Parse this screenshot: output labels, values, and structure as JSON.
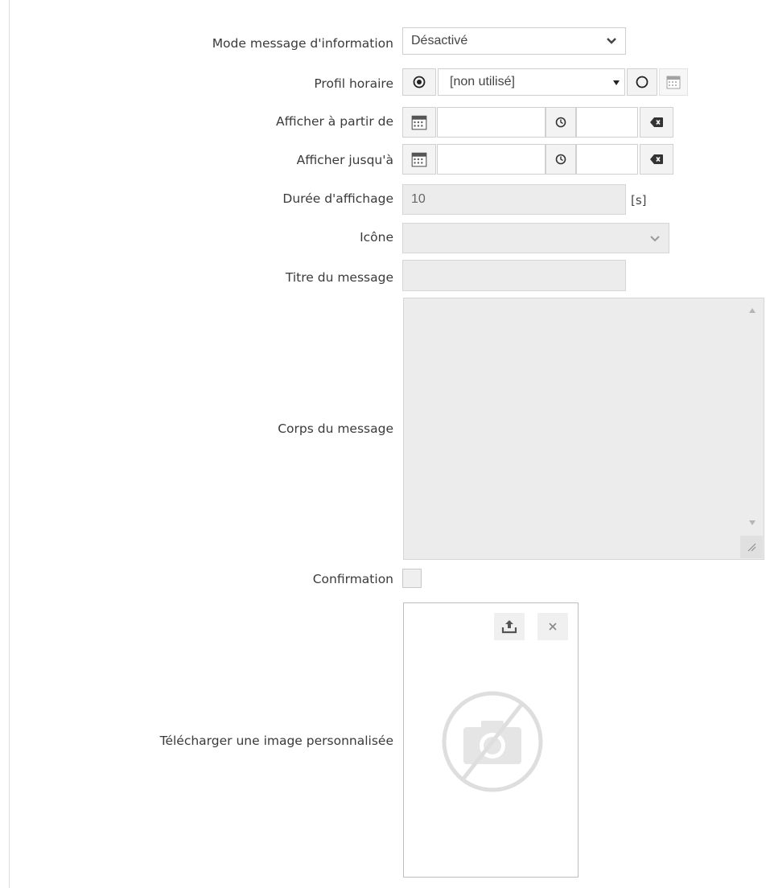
{
  "form": {
    "mode": {
      "label": "Mode message d'information",
      "value": "Désactivé"
    },
    "profile": {
      "label": "Profil horaire",
      "value": "[non utilisé]"
    },
    "from": {
      "label": "Afficher à partir de"
    },
    "until": {
      "label": "Afficher jusqu'à"
    },
    "duration": {
      "label": "Durée d'affichage",
      "value": "10",
      "unit": "[s]"
    },
    "icon": {
      "label": "Icône",
      "value": ""
    },
    "title": {
      "label": "Titre du message",
      "value": ""
    },
    "body": {
      "label": "Corps du message",
      "value": ""
    },
    "confirmation": {
      "label": "Confirmation",
      "checked": false
    },
    "image": {
      "label": "Télécharger une image personnalisée"
    }
  },
  "icons": {
    "mode_select": "chevron-down-icon",
    "profile_radio_on": "radio-selected-icon",
    "profile_select": "caret-down-icon",
    "profile_radio_off": "radio-empty-icon",
    "calendar": "calendar-icon",
    "clock": "clock-icon",
    "clear": "backspace-clear-icon",
    "icon_select": "chevron-down-icon",
    "upload": "upload-icon",
    "remove": "close-icon",
    "no_image": "no-camera-icon"
  }
}
